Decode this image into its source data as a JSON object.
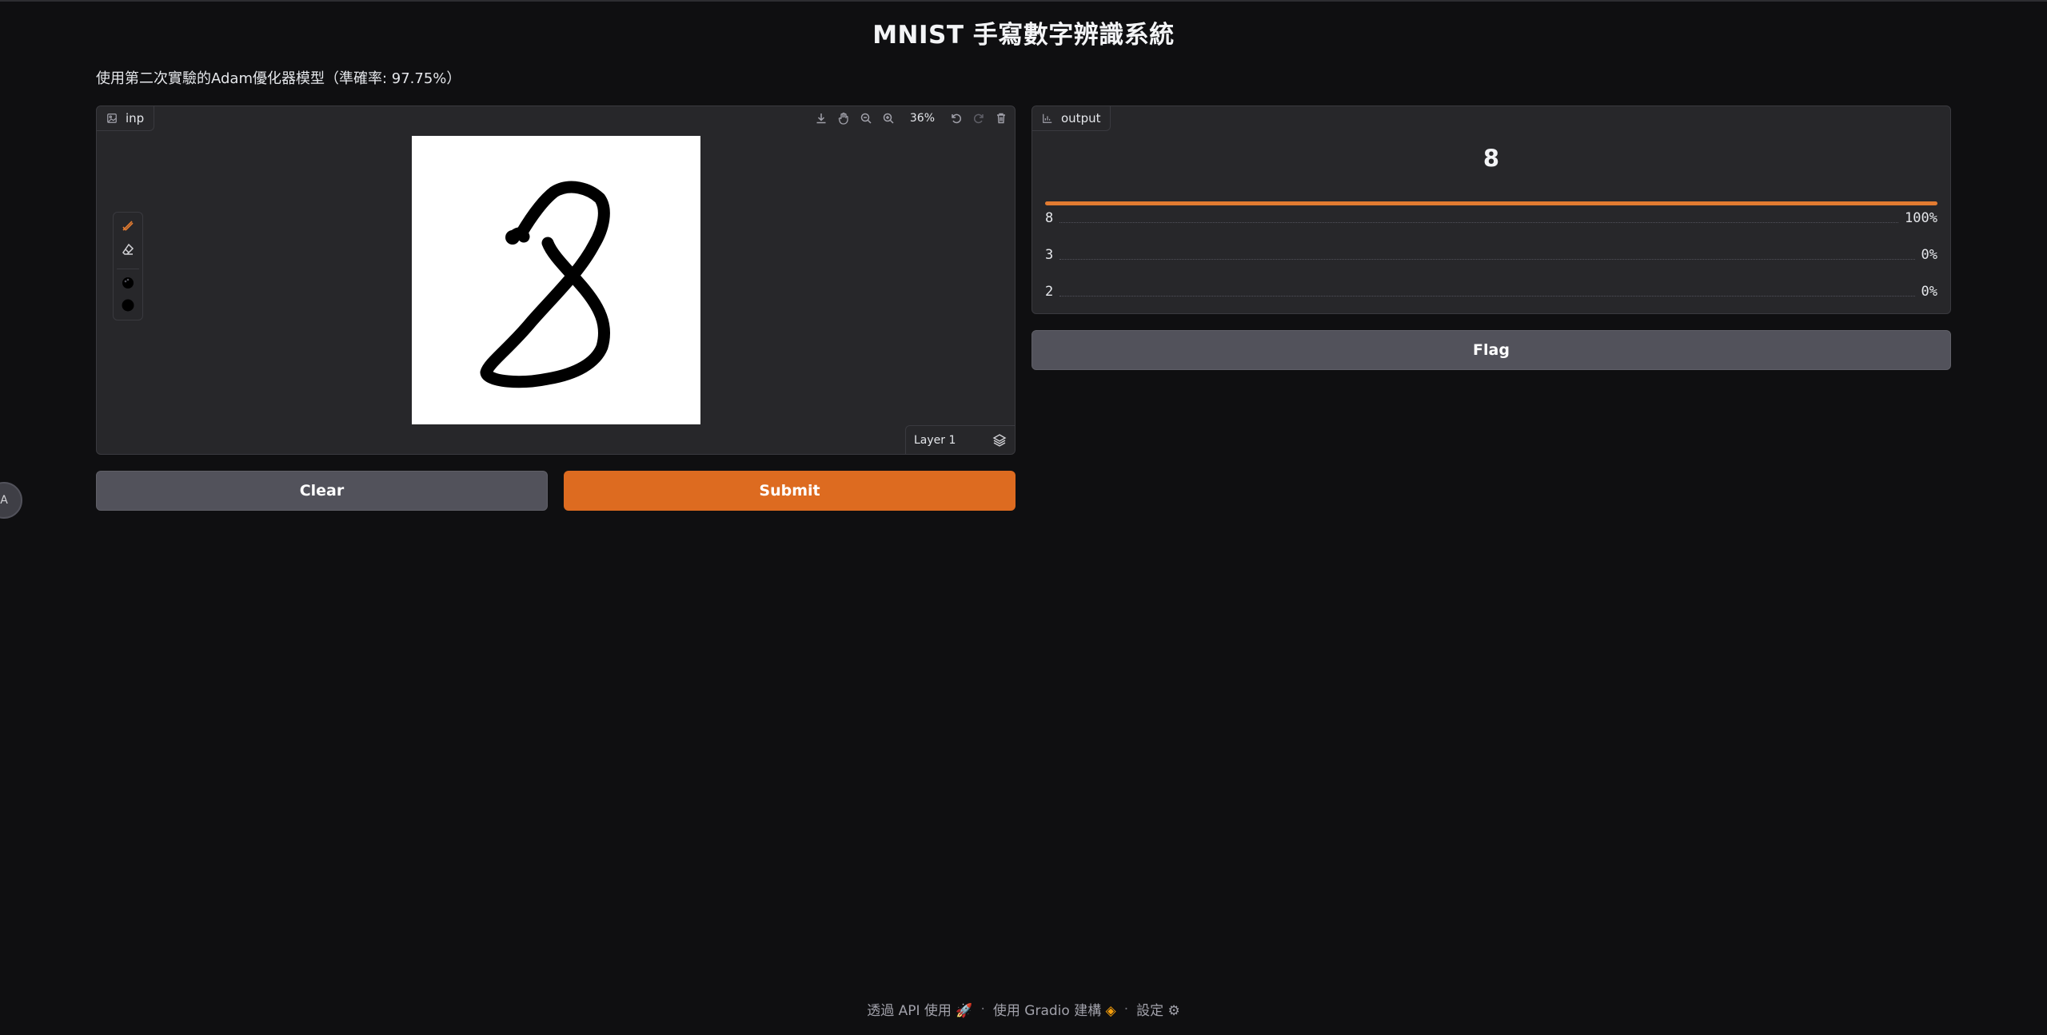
{
  "header": {
    "title": "MNIST 手寫數字辨識系統",
    "subtitle": "使用第二次實驗的Adam優化器模型（準確率: 97.75%）"
  },
  "input_panel": {
    "label": "inp",
    "zoom": "36%",
    "layer": "Layer 1",
    "toolbar_icons": [
      "download-icon",
      "pan-icon",
      "zoom-out-icon",
      "zoom-in-icon",
      "undo-icon",
      "redo-icon",
      "trash-icon"
    ],
    "side_tools": [
      "brush-icon",
      "eraser-icon",
      "color-palette-icon",
      "brush-size-icon"
    ]
  },
  "buttons": {
    "clear": "Clear",
    "submit": "Submit",
    "flag": "Flag"
  },
  "output_panel": {
    "label": "output",
    "value": "8",
    "top_confidence": 1.0,
    "confidences": [
      {
        "label": "8",
        "value": "100%"
      },
      {
        "label": "3",
        "value": "0%"
      },
      {
        "label": "2",
        "value": "0%"
      }
    ]
  },
  "footer": {
    "api": "透過 API 使用",
    "built": "使用 Gradio 建構",
    "settings": "設定"
  },
  "colors": {
    "accent": "#dd6b20",
    "background": "#0f0f11",
    "panel": "#27272a"
  }
}
